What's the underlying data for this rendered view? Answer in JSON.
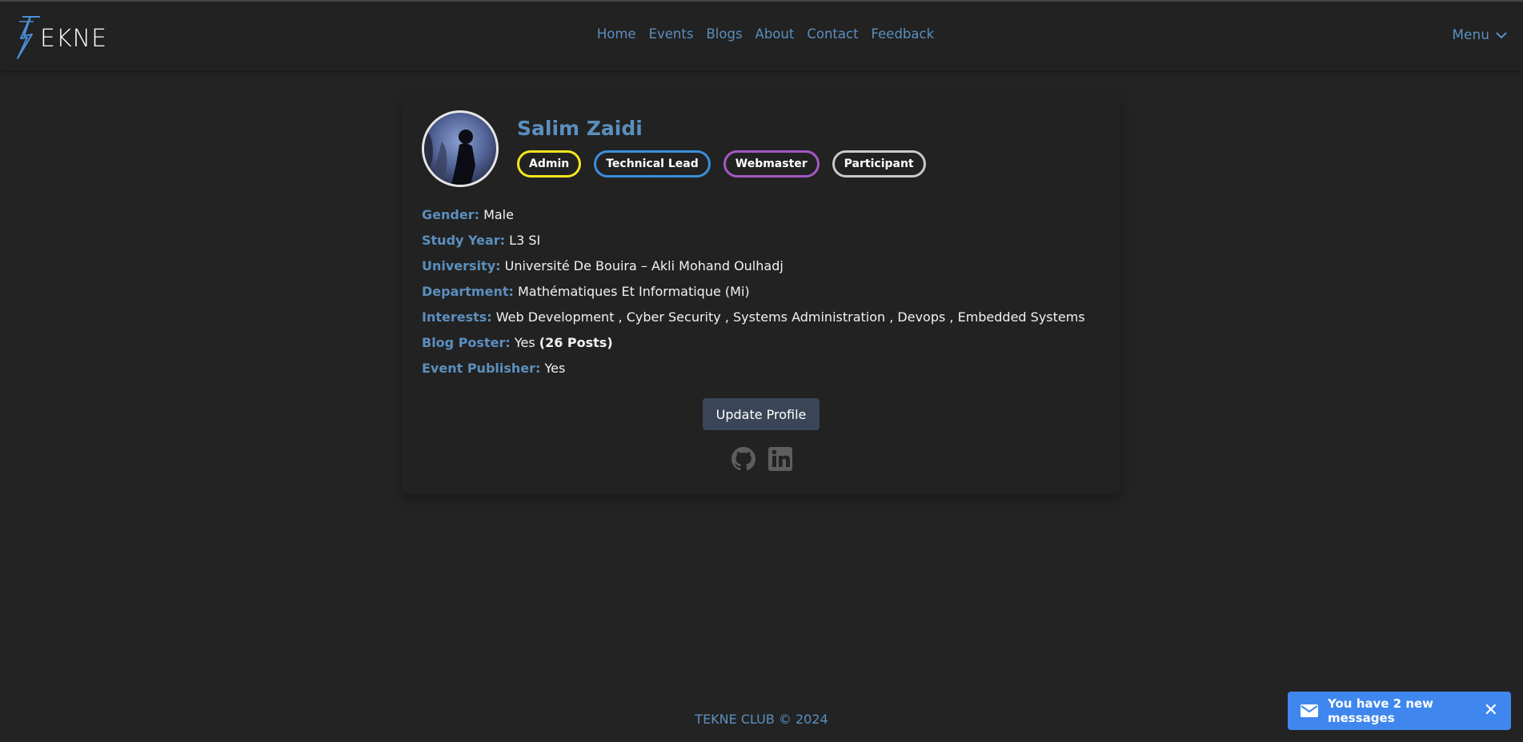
{
  "brand": {
    "logo_text": "EKNE"
  },
  "nav": {
    "links": [
      {
        "label": "Home"
      },
      {
        "label": "Events"
      },
      {
        "label": "Blogs"
      },
      {
        "label": "About"
      },
      {
        "label": "Contact"
      },
      {
        "label": "Feedback"
      }
    ],
    "menu_label": "Menu"
  },
  "profile": {
    "name": "Salim Zaidi",
    "roles": [
      {
        "label": "Admin",
        "color": "#f5e61c"
      },
      {
        "label": "Technical Lead",
        "color": "#3b8fdc"
      },
      {
        "label": "Webmaster",
        "color": "#a259c4"
      },
      {
        "label": "Participant",
        "color": "#c9c9c9"
      }
    ],
    "fields": {
      "gender": {
        "label": "Gender:",
        "value": "Male"
      },
      "study_year": {
        "label": "Study Year:",
        "value": "L3 SI"
      },
      "university": {
        "label": "University:",
        "value": "Université De Bouira – Akli Mohand Oulhadj"
      },
      "department": {
        "label": "Department:",
        "value": "Mathématiques Et Informatique (Mi)"
      },
      "interests": {
        "label": "Interests:",
        "value": "Web Development , Cyber Security , Systems Administration , Devops , Embedded Systems"
      },
      "blog_poster": {
        "label": "Blog Poster:",
        "value": "Yes",
        "extra": "(26 Posts)"
      },
      "event_publisher": {
        "label": "Event Publisher:",
        "value": "Yes"
      }
    },
    "update_button": "Update Profile",
    "socials": [
      "github-icon",
      "linkedin-icon"
    ]
  },
  "footer": {
    "text": "TEKNE CLUB © 2024"
  },
  "toast": {
    "message": "You have 2 new messages",
    "close": "✕"
  },
  "colors": {
    "background": "#232323",
    "accent": "#5b8fbe",
    "toast": "#3f87ee",
    "button": "#3a4557"
  }
}
